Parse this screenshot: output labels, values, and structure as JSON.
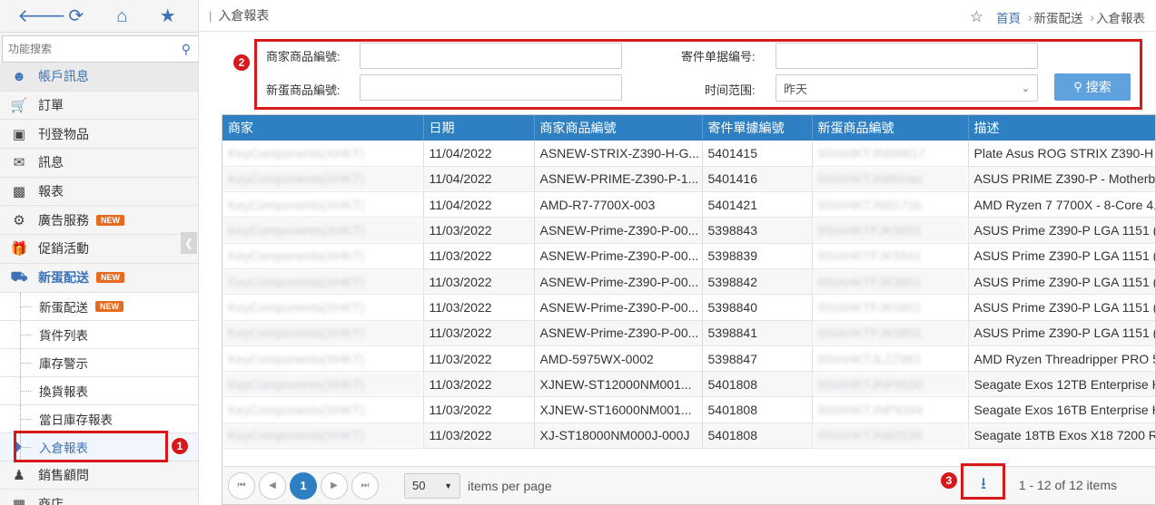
{
  "sidebar": {
    "search_placeholder": "功能搜索",
    "menu": [
      {
        "label": "帳戶訊息",
        "icon": "user-icon"
      },
      {
        "label": "訂單",
        "icon": "cart-icon"
      },
      {
        "label": "刊登物品",
        "icon": "archive-icon"
      },
      {
        "label": "訊息",
        "icon": "envelope-icon"
      },
      {
        "label": "報表",
        "icon": "bar-chart-icon"
      },
      {
        "label": "廣告服務",
        "icon": "gears-icon",
        "badge": "NEW"
      },
      {
        "label": "促銷活動",
        "icon": "gift-icon"
      },
      {
        "label": "新蛋配送",
        "icon": "truck-icon",
        "badge": "NEW"
      }
    ],
    "sub_items": [
      {
        "label": "新蛋配送",
        "badge": "NEW"
      },
      {
        "label": "貨件列表"
      },
      {
        "label": "庫存警示"
      },
      {
        "label": "換貨報表"
      },
      {
        "label": "當日庫存報表"
      },
      {
        "label": "入倉報表"
      }
    ],
    "after_items": [
      {
        "label": "銷售顧問",
        "icon": "advisor-icon"
      },
      {
        "label": "商店",
        "icon": "store-icon"
      }
    ]
  },
  "header": {
    "title": "入倉報表",
    "breadcrumb": {
      "home": "首頁",
      "section": "新蛋配送",
      "current": "入倉報表"
    }
  },
  "filter": {
    "merchant_sku_label": "商家商品編號:",
    "merchant_sku_value": "",
    "newegg_sku_label": "新蛋商品編號:",
    "newegg_sku_value": "",
    "shipment_no_label": "寄件单据编号:",
    "shipment_no_value": "",
    "time_range_label": "时间范围:",
    "time_range_value": "昨天",
    "search_label": "搜索"
  },
  "annotations": {
    "one": "1",
    "two": "2",
    "three": "3"
  },
  "table": {
    "columns": [
      "商家",
      "日期",
      "商家商品編號",
      "寄件單據編號",
      "新蛋商品編號",
      "描述"
    ],
    "rows": [
      [
        "KeyComponents(XHKT)",
        "11/04/2022",
        "ASNEW-STRIX-Z390-H-G...",
        "5401415",
        "9SIAHKTJN8M817",
        "Plate Asus ROG STRIX Z390-H G"
      ],
      [
        "KeyComponents(XHKT)",
        "11/04/2022",
        "ASNEW-PRIME-Z390-P-1...",
        "5401416",
        "9SIAHKTJN8Rnav",
        "ASUS PRIME Z390-P - Motherbo"
      ],
      [
        "KeyComponents(XHKT)",
        "11/04/2022",
        "AMD-R7-7700X-003",
        "5401421",
        "9SIAHKTJN9171b",
        "AMD Ryzen 7 7700X - 8-Core 4.5"
      ],
      [
        "KeyComponents(XHKT)",
        "11/03/2022",
        "ASNEW-Prime-Z390-P-00...",
        "5398843",
        "9SIAHKTFJK5851",
        "ASUS Prime Z390-P LGA 1151 (3"
      ],
      [
        "KeyComponents(XHKT)",
        "11/03/2022",
        "ASNEW-Prime-Z390-P-00...",
        "5398839",
        "9SIAHKTFJK5841",
        "ASUS Prime Z390-P LGA 1151 (3"
      ],
      [
        "KeyComponents(XHKT)",
        "11/03/2022",
        "ASNEW-Prime-Z390-P-00...",
        "5398842",
        "9SIAHKTFJK5851",
        "ASUS Prime Z390-P LGA 1151 (3"
      ],
      [
        "KeyComponents(XHKT)",
        "11/03/2022",
        "ASNEW-Prime-Z390-P-00...",
        "5398840",
        "9SIAHKTFJK5851",
        "ASUS Prime Z390-P LGA 1151 (3"
      ],
      [
        "KeyComponents(XHKT)",
        "11/03/2022",
        "ASNEW-Prime-Z390-P-00...",
        "5398841",
        "9SIAHKTFJK5851",
        "ASUS Prime Z390-P LGA 1151 (3"
      ],
      [
        "KeyComponents(XHKT)",
        "11/03/2022",
        "AMD-5975WX-0002",
        "5398847",
        "9SIAHKTJLZZ962",
        "AMD Ryzen Threadripper PRO 59"
      ],
      [
        "KeyComponents(XHKT)",
        "11/03/2022",
        "XJNEW-ST12000NM001...",
        "5401808",
        "9SIAHKTJNP9530",
        "Seagate Exos 12TB Enterprise H"
      ],
      [
        "KeyComponents(XHKT)",
        "11/03/2022",
        "XJNEW-ST16000NM001...",
        "5401808",
        "9SIAHKTJNP9344",
        "Seagate Exos 16TB Enterprise H"
      ],
      [
        "KeyComponents(XHKT)",
        "11/03/2022",
        "XJ-ST18000NM000J-000J",
        "5401808",
        "9SIAHKTJN82539",
        "Seagate 18TB Exos X18 7200 RI"
      ]
    ]
  },
  "pager": {
    "current_page": "1",
    "page_size": "50",
    "per_page_label": "items per page",
    "info": "1 - 12 of 12 items"
  },
  "colors": {
    "accent": "#3d72b4",
    "header_blue": "#2e80c2",
    "badge_orange": "#e76b1e",
    "annotation_red": "#d7191c"
  }
}
